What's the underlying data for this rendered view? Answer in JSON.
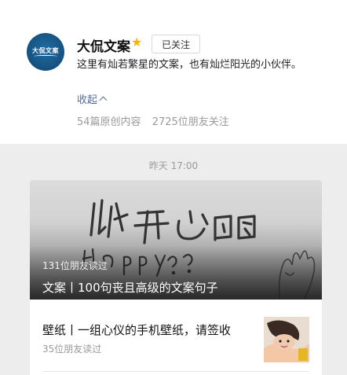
{
  "account": {
    "name": "大侃文案",
    "avatar_text": "大侃文案",
    "follow_label": "已关注",
    "description": "这里有灿若繁星的文案，也有灿烂阳光的小伙伴。",
    "collapse_label": "收起",
    "stats": {
      "original_count": "54篇原创内容",
      "followers_count": "2725位朋友关注"
    }
  },
  "feed": {
    "date": "昨天 17:00",
    "cover_article": {
      "reads": "131位朋友读过",
      "title": "文案丨100句丧且高级的文案句子"
    },
    "list_article": {
      "title": "壁纸丨一组心仪的手机壁纸，请签收",
      "reads": "35位朋友读过"
    }
  },
  "colors": {
    "link": "#576b95",
    "star": "#f5b400",
    "avatar": "#15507d",
    "feed_background": "#ededed"
  },
  "icons": [
    "more-icon",
    "star-icon",
    "chevron-up-icon"
  ]
}
